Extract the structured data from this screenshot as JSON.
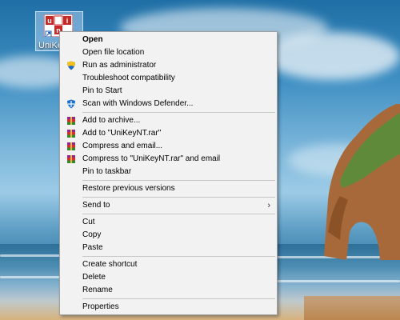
{
  "desktop": {
    "icon_label": "UniKeyNT",
    "icon_name": "unikey-app-icon"
  },
  "context_menu": {
    "groups": [
      [
        {
          "label": "Open",
          "bold": true,
          "icon": ""
        },
        {
          "label": "Open file location",
          "icon": ""
        },
        {
          "label": "Run as administrator",
          "icon": "uac-shield-icon"
        },
        {
          "label": "Troubleshoot compatibility",
          "icon": ""
        },
        {
          "label": "Pin to Start",
          "icon": ""
        },
        {
          "label": "Scan with Windows Defender...",
          "icon": "windows-defender-icon"
        }
      ],
      [
        {
          "label": "Add to archive...",
          "icon": "winrar-icon"
        },
        {
          "label": "Add to \"UniKeyNT.rar\"",
          "icon": "winrar-icon"
        },
        {
          "label": "Compress and email...",
          "icon": "winrar-icon"
        },
        {
          "label": "Compress to \"UniKeyNT.rar\" and email",
          "icon": "winrar-icon"
        },
        {
          "label": "Pin to taskbar",
          "icon": ""
        }
      ],
      [
        {
          "label": "Restore previous versions",
          "icon": ""
        }
      ],
      [
        {
          "label": "Send to",
          "icon": "",
          "submenu": true
        }
      ],
      [
        {
          "label": "Cut",
          "icon": ""
        },
        {
          "label": "Copy",
          "icon": ""
        },
        {
          "label": "Paste",
          "icon": ""
        }
      ],
      [
        {
          "label": "Create shortcut",
          "icon": ""
        },
        {
          "label": "Delete",
          "icon": ""
        },
        {
          "label": "Rename",
          "icon": ""
        }
      ],
      [
        {
          "label": "Properties",
          "icon": ""
        }
      ]
    ],
    "submenu_arrow": "›"
  }
}
